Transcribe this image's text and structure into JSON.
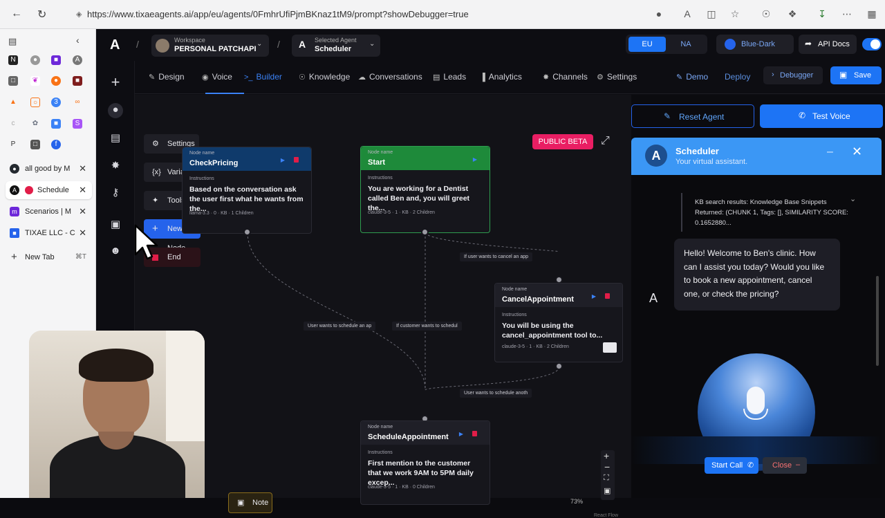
{
  "browser": {
    "url": "https://www.tixaeagents.ai/app/eu/agents/0FmhrUfiPjmBKnaz1tM9/prompt?showDebugger=true",
    "tabs": [
      {
        "label": "all good by M",
        "icon": "github-icon",
        "color": "#24292f"
      },
      {
        "label": "Schedule",
        "icon": "tixae-icon",
        "color": "#111111",
        "active": true
      },
      {
        "label": "Scenarios | M",
        "icon": "make-icon",
        "color": "#6d28d9"
      },
      {
        "label": "TIXAE LLC - C",
        "icon": "doc-icon",
        "color": "#2563eb"
      }
    ],
    "new_tab": "New Tab",
    "new_tab_shortcut": "⌘T"
  },
  "app": {
    "logo": "A",
    "workspace_label": "Workspace",
    "workspace_name": "PERSONAL PATCHAPI",
    "agent_label": "Selected Agent",
    "agent_name": "Scheduler",
    "region_eu": "EU",
    "region_na": "NA",
    "theme": "Blue-Dark",
    "api_docs": "API Docs",
    "nav_tabs": [
      "Design",
      "Voice",
      "Builder",
      "Knowledge",
      "Conversations",
      "Leads",
      "Analytics",
      "Channels",
      "Settings"
    ],
    "active_tab": "Builder",
    "demo": "Demo",
    "deploy": "Deploy",
    "debugger": "Debugger",
    "save": "Save"
  },
  "canvas": {
    "side_buttons": {
      "settings": "Settings",
      "variables": "Variables",
      "tools": "Tools",
      "new_node": "New Node",
      "end": "End"
    },
    "public_beta": "PUBLIC BETA",
    "node_name_label": "Node name",
    "instructions_label": "Instructions",
    "nodes": {
      "checkpricing": {
        "title": "CheckPricing",
        "body": "Based on the conversation ask the user first what he wants from the...",
        "meta": "llama-3.3 · 0 · KB · 1 Children"
      },
      "start": {
        "title": "Start",
        "body": "You are working for a Dentist called Ben and, you will greet the...",
        "meta": "claude-3-5 · 1 · KB · 2 Children"
      },
      "cancel": {
        "title": "CancelAppointment",
        "body": "You will be using the cancel_appointment tool to...",
        "meta": "claude-3-5 · 1 · KB · 2 Children"
      },
      "schedule": {
        "title": "ScheduleAppointment",
        "body": "First mention to the customer that we work 9AM to 5PM daily excep...",
        "meta": "claude-3-5 · 1 · KB · 0 Children"
      }
    },
    "edge_labels": {
      "cancel": "If user wants to cancel an app",
      "schedule_left": "User wants to schedule an ap",
      "schedule_mid": "If customer wants to schedul",
      "schedule_right": "User wants to schedule anoth"
    },
    "note": "Note",
    "zoom": "73%",
    "react_flow": "React Flow"
  },
  "panel": {
    "reset_agent": "Reset Agent",
    "test_voice": "Test Voice",
    "chat_title": "Scheduler",
    "chat_subtitle": "Your virtual assistant.",
    "kb_result": "KB search results: Knowledge Base Snippets Returned: (CHUNK 1, Tags: [], SIMILARITY SCORE: 0.1652880...",
    "assistant_message": "Hello! Welcome to Ben's clinic. How can I assist you today? Would you like to book a new appointment, cancel one, or check the pricing?",
    "avatar_letter": "A",
    "start_call": "Start Call",
    "close": "Close"
  },
  "colors": {
    "accent_blue": "#1d74f5",
    "start_green": "#1e8a3a",
    "pricing_blue": "#0f3a6b",
    "public_beta_pink": "#e91e63",
    "end_red": "#e11d48"
  }
}
